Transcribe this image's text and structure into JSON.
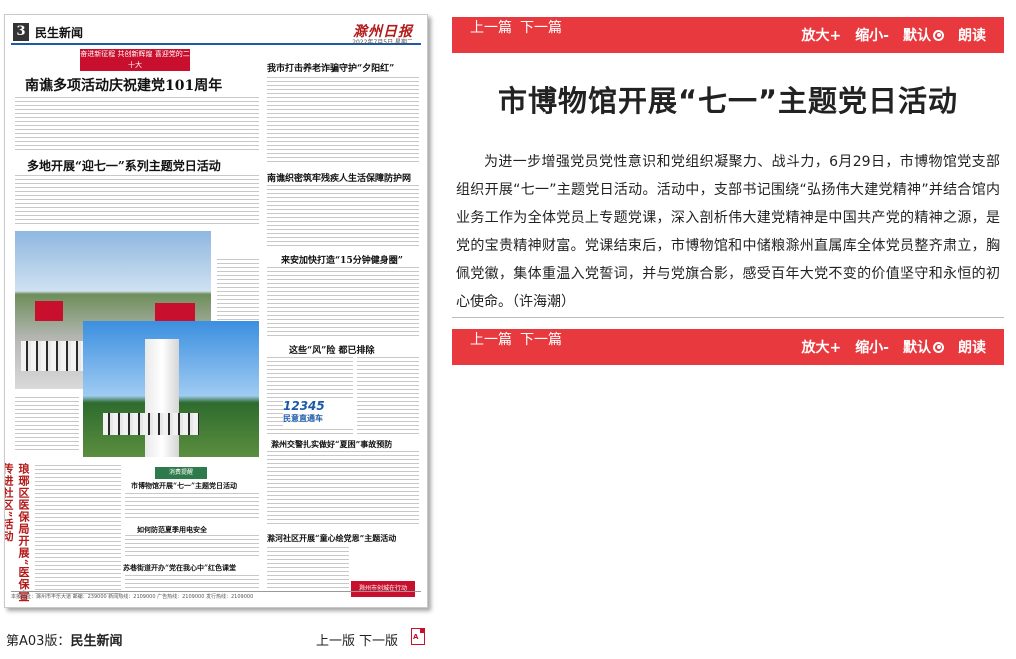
{
  "paper": {
    "page_num": "3",
    "section": "民生新闻",
    "logo": "滁州日报",
    "date": "2022年7月5日 星期二",
    "banner": "奋进新征程 共创新辉煌 喜迎党的二十大",
    "headlines": {
      "h1": "南谯多项活动庆祝建党101周年",
      "h2": "多地开展“迎七一”系列主题党日活动",
      "h3": "我市打击养老诈骗守护“夕阳红”",
      "h4": "南谯织密筑牢残疾人生活保障防护网",
      "h5": "来安加快打造“15分钟健身圈”",
      "h6": "这些“风”险 都已排除",
      "h7": "滁州交警扎实做好“夏困”事故预防",
      "h8": "市博物馆开展“七一”主题党日活动",
      "h9": "如何防范夏季用电安全",
      "h10": "苏巷街道开办“党在我心中”红色课堂",
      "h11": "滁河社区开展“童心绘党恩”主题活动"
    },
    "vertical_title": "琅琊区医保局开展“医保宣传进社区”活动",
    "mini_banner": "消费提醒",
    "badge_number": "12345",
    "badge_sub": "民意直通车",
    "red_box": "滁州市创城在行动",
    "footer": "本报地址：滁州市丰乐大道 邮编：239000 新闻热线：2109000 广告热线：2109000 发行热线：2109000"
  },
  "edition_caption": {
    "prefix": "第A03版：",
    "name": "民生新闻"
  },
  "left_nav": {
    "prev": "上一版",
    "next": "下一版"
  },
  "toolbar": {
    "prev": "上一篇",
    "next": "下一篇",
    "zoom_in": "放大+",
    "zoom_out": "缩小-",
    "default": "默认",
    "read_aloud": "朗读"
  },
  "article": {
    "title": "市博物馆开展“七一”主题党日活动",
    "body": "为进一步增强党员党性意识和党组织凝聚力、战斗力，6月29日，市博物馆党支部组织开展“七一”主题党日活动。活动中，支部书记围绕“弘扬伟大建党精神”并结合馆内业务工作为全体党员上专题党课，深入剖析伟大建党精神是中国共产党的精神之源，是党的宝贵精神财富。党课结束后，市博物馆和中储粮滁州直属库全体党员整齐肃立，胸佩党徽，集体重温入党誓词，并与党旗合影，感受百年大党不变的价值坚守和永恒的初心使命。（许海潮）"
  },
  "colors": {
    "toolbar_red": "#e8393e",
    "masthead_blue": "#1a5aa8",
    "headline_red": "#b31a1a"
  }
}
